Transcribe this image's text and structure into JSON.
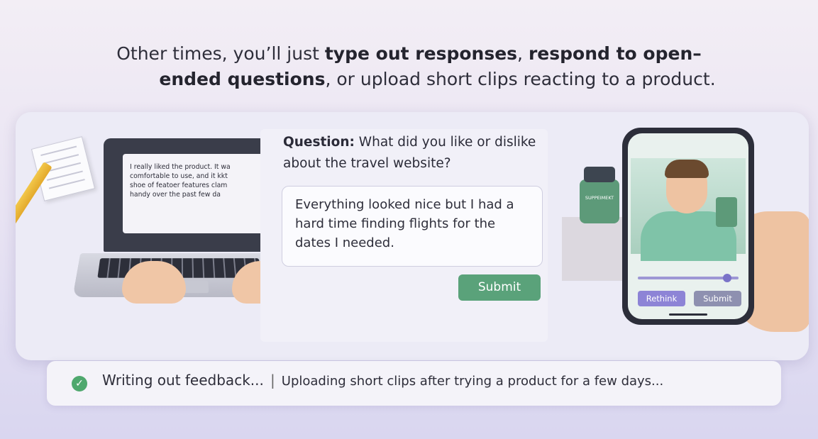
{
  "headline": {
    "part1": "Other times, you’ll just ",
    "bold1": "type out responses",
    "part2": ", ",
    "bold2": "respond to open–",
    "bold3": "ended questions",
    "part3": ", or upload short clips reacting to a product."
  },
  "laptop": {
    "lines": [
      "I really liked the product. It wa",
      "comfortable to use, and it kkt",
      "shoe of featoer features clam",
      "handy over the past few da"
    ]
  },
  "question": {
    "label": "Question:",
    "text": " What did you like or dislike about the travel website?",
    "answer": "Everything looked nice but I had a hard time finding flights for the dates I needed.",
    "submit": "Submit"
  },
  "phone": {
    "jar_label": "SUPPEIMEKT",
    "rethink": "Rethink",
    "submit": "Submit"
  },
  "status": {
    "item1": "Writing out feedback...",
    "separator": "|",
    "item2": "Uploading short clips after trying a product for a few days..."
  },
  "colors": {
    "accent_green": "#5aa27a",
    "phone_button": "#8d84d6",
    "check": "#4fa86e"
  }
}
